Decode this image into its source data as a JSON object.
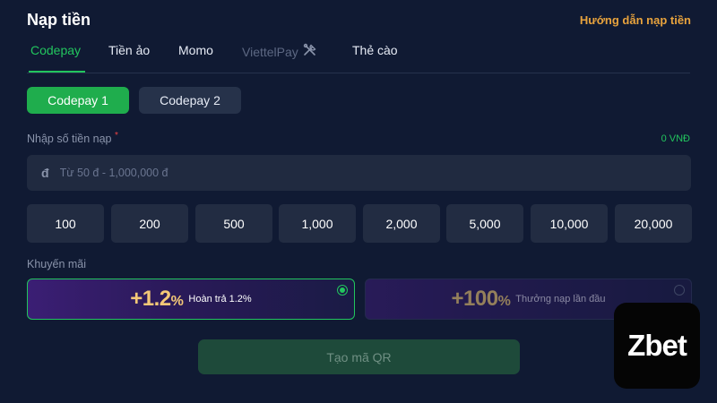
{
  "header": {
    "title": "Nạp tiền",
    "guide_link": "Hướng dẫn nạp tiền"
  },
  "tabs": [
    {
      "label": "Codepay"
    },
    {
      "label": "Tiền ảo"
    },
    {
      "label": "Momo"
    },
    {
      "label": "ViettelPay"
    },
    {
      "label": "Thẻ cào"
    }
  ],
  "subtabs": [
    {
      "label": "Codepay 1"
    },
    {
      "label": "Codepay 2"
    }
  ],
  "amount": {
    "label": "Nhập số tiền nạp",
    "required_mark": "*",
    "balance": "0 VNĐ",
    "currency_symbol": "đ",
    "placeholder": "Từ 50 đ - 1,000,000 đ"
  },
  "presets": [
    "100",
    "200",
    "500",
    "1,000",
    "2,000",
    "5,000",
    "10,000",
    "20,000"
  ],
  "promo": {
    "label": "Khuyến mãi",
    "options": [
      {
        "value": "+1.2",
        "sign": "%",
        "text": "Hoàn trả 1.2%",
        "selected": true
      },
      {
        "value": "+100",
        "sign": "%",
        "text": "Thưởng nạp lần đầu",
        "selected": false
      }
    ]
  },
  "qr_button": "Tạo mã QR",
  "logo": {
    "text": "Zbet"
  },
  "colors": {
    "accent": "#22c55e",
    "gold": "#e8a33d",
    "background": "#101a33"
  },
  "icons": {
    "viettelpay_status": "tools-icon"
  }
}
